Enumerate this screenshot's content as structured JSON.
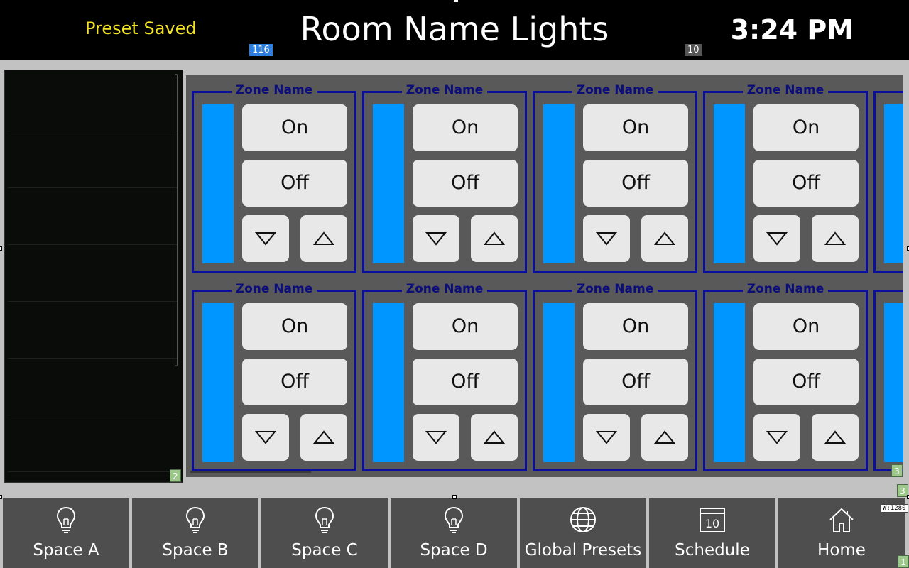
{
  "header": {
    "status": "Preset Saved",
    "title": "Room Name Lights",
    "clock": "3:24 PM",
    "debug_tag_left": "116",
    "debug_tag_right": "10"
  },
  "left_panel": {
    "tag": "2"
  },
  "zones": {
    "tag": "3",
    "rows": [
      [
        {
          "name": "Zone Name",
          "on": "On",
          "off": "Off"
        },
        {
          "name": "Zone Name",
          "on": "On",
          "off": "Off"
        },
        {
          "name": "Zone Name",
          "on": "On",
          "off": "Off"
        },
        {
          "name": "Zone Name",
          "on": "On",
          "off": "Off"
        }
      ],
      [
        {
          "name": "Zone Name",
          "on": "On",
          "off": "Off"
        },
        {
          "name": "Zone Name",
          "on": "On",
          "off": "Off"
        },
        {
          "name": "Zone Name",
          "on": "On",
          "off": "Off"
        },
        {
          "name": "Zone Name",
          "on": "On",
          "off": "Off"
        }
      ]
    ],
    "bar_color": "#0096ff",
    "border_color": "#0a0e9c"
  },
  "nav": {
    "items": [
      {
        "label": "Space A",
        "icon": "lightbulb-icon"
      },
      {
        "label": "Space B",
        "icon": "lightbulb-icon"
      },
      {
        "label": "Space C",
        "icon": "lightbulb-icon"
      },
      {
        "label": "Space D",
        "icon": "lightbulb-icon"
      },
      {
        "label": "Global Presets",
        "icon": "globe-icon"
      },
      {
        "label": "Schedule",
        "icon": "calendar-icon",
        "icon_text": "10"
      },
      {
        "label": "Home",
        "icon": "home-icon"
      }
    ],
    "tag_side": "3",
    "tag_corner": "1",
    "width_tag": "W:1280"
  }
}
